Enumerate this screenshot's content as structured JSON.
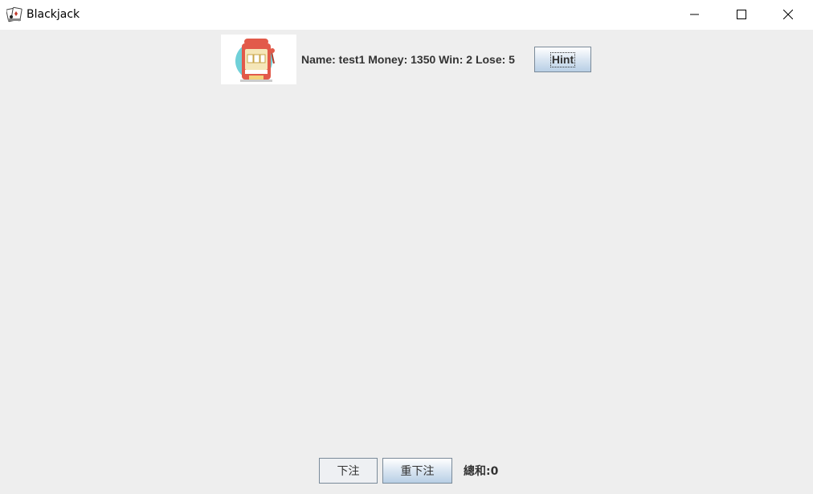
{
  "window": {
    "title": "Blackjack"
  },
  "player": {
    "stats_text": "Name: test1 Money: 1350 Win: 2 Lose: 5"
  },
  "buttons": {
    "hint_label": "Hint",
    "bet_label": "下注",
    "rebet_label": "重下注"
  },
  "footer": {
    "sum_text": "總和:0"
  },
  "icons": {
    "app": "blackjack-cards-icon",
    "slot": "slot-machine-icon",
    "minimize": "minimize-icon",
    "maximize": "maximize-icon",
    "close": "close-icon"
  },
  "colors": {
    "background": "#eeeeee",
    "titlebar": "#ffffff",
    "button_gradient_top": "#ffffff",
    "button_gradient_bottom": "#b8cfe5",
    "text": "#333333"
  }
}
